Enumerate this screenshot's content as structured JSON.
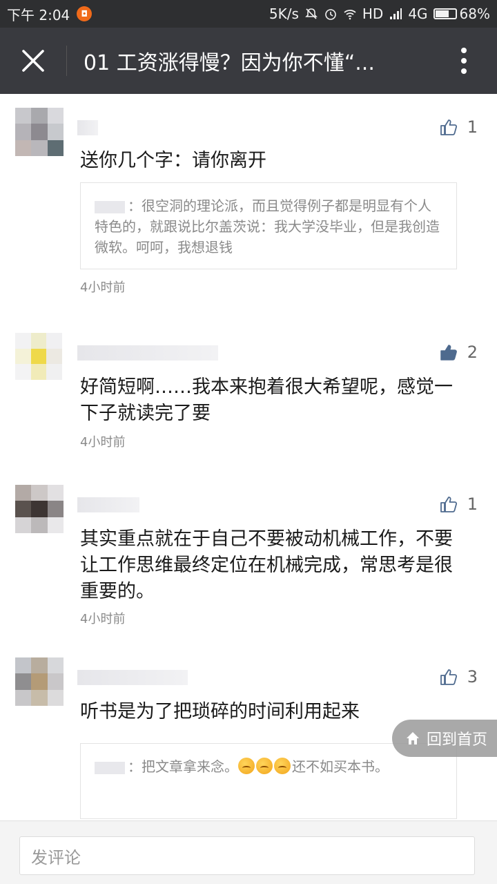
{
  "status_bar": {
    "time": "下午 2:04",
    "network_speed": "5K/s",
    "hd": "HD",
    "network_type": "4G",
    "battery": "68%",
    "battery_level": 0.68
  },
  "header": {
    "title": "01 工资涨得慢？因为你不懂“..."
  },
  "comments": [
    {
      "likes": "1",
      "liked": false,
      "text": "送你几个字：请你离开",
      "reply": "：很空洞的理论派，而且觉得例子都是明显有个人特色的，就跟说比尔盖茨说：我大学没毕业，但是我创造微软。呵呵，我想退钱",
      "time": "4小时前"
    },
    {
      "likes": "2",
      "liked": true,
      "text": "好简短啊……我本来抱着很大希望呢，感觉一下子就读完了要",
      "time": "4小时前"
    },
    {
      "likes": "1",
      "liked": false,
      "text": "其实重点就在于自己不要被动机械工作，不要让工作思维最终定位在机械完成，常思考是很重要的。",
      "time": "4小时前"
    },
    {
      "likes": "3",
      "liked": false,
      "text": "听书是为了把琐碎的时间利用起来",
      "reply_prefix": "：把文章拿来念。",
      "reply_suffix": "还不如买本书。"
    }
  ],
  "home_button": "回到首页",
  "comment_input": {
    "placeholder": "发评论"
  },
  "colors": {
    "status_bar": "#2e2f31",
    "title_bar": "#393a3f",
    "liked_icon": "#4e6a8e",
    "meta_text": "#8a8a8a"
  }
}
